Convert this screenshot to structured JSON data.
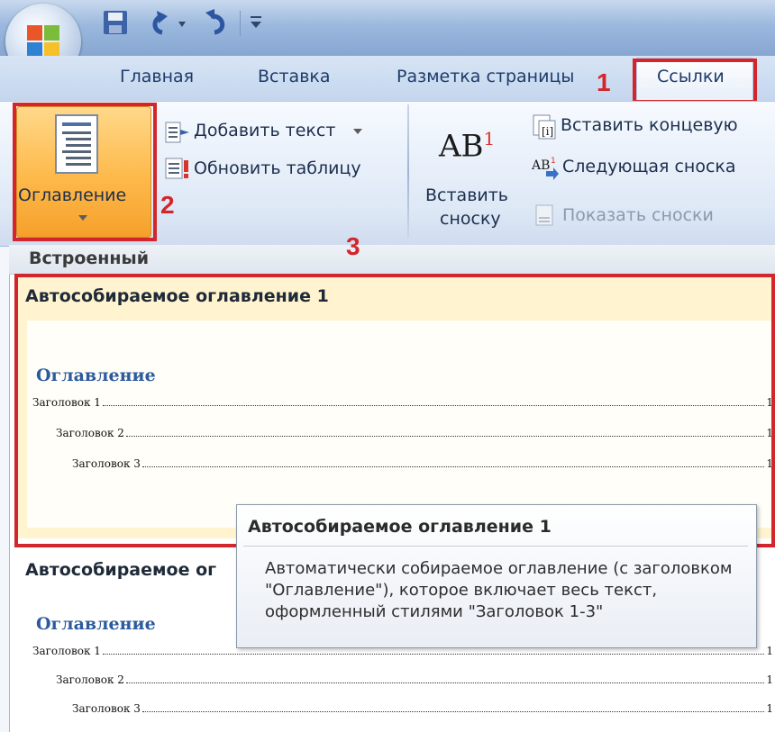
{
  "quick_access": {
    "save_icon": "save-icon",
    "undo_icon": "undo-icon",
    "redo_icon": "redo-icon",
    "customize_icon": "customize-arrow-icon"
  },
  "tabs": [
    {
      "label": "Главная"
    },
    {
      "label": "Вставка"
    },
    {
      "label": "Разметка страницы"
    },
    {
      "label": "Ссылки"
    }
  ],
  "ribbon": {
    "toc_button_label": "Оглавление",
    "add_text_label": "Добавить текст",
    "update_table_label": "Обновить таблицу",
    "insert_footnote_label_1": "Вставить",
    "insert_footnote_label_2": "сноску",
    "footnote_icon_text": "AB",
    "footnote_icon_sup": "1",
    "insert_endnote_label": "Вставить концевую",
    "next_footnote_label": "Следующая сноска",
    "show_notes_label": "Показать сноски"
  },
  "gallery": {
    "section_label": "Встроенный",
    "items": [
      {
        "title": "Автособираемое оглавление 1",
        "heading": "Оглавление",
        "entries": [
          {
            "text": "Заголовок 1",
            "page": "1"
          },
          {
            "text": "Заголовок 2",
            "page": "1"
          },
          {
            "text": "Заголовок 3",
            "page": "1"
          }
        ]
      },
      {
        "title": "Автособираемое ог",
        "heading": "Оглавление",
        "entries": [
          {
            "text": "Заголовок 1",
            "page": "1"
          },
          {
            "text": "Заголовок 2",
            "page": "1"
          },
          {
            "text": "Заголовок 3",
            "page": "1"
          }
        ]
      }
    ]
  },
  "tooltip": {
    "title": "Автособираемое оглавление 1",
    "description": "Автоматически собираемое оглавление (с заголовком \"Оглавление\"), которое включает весь текст, оформленный стилями \"Заголовок 1-3\""
  },
  "annotations": {
    "step1": "1",
    "step2": "2",
    "step3": "3",
    "color": "#d3262c"
  },
  "colors": {
    "accent_orange": "#fdb94a",
    "toc_heading_blue": "#2c5a9e",
    "ribbon_blue": "#c4d6ee"
  }
}
